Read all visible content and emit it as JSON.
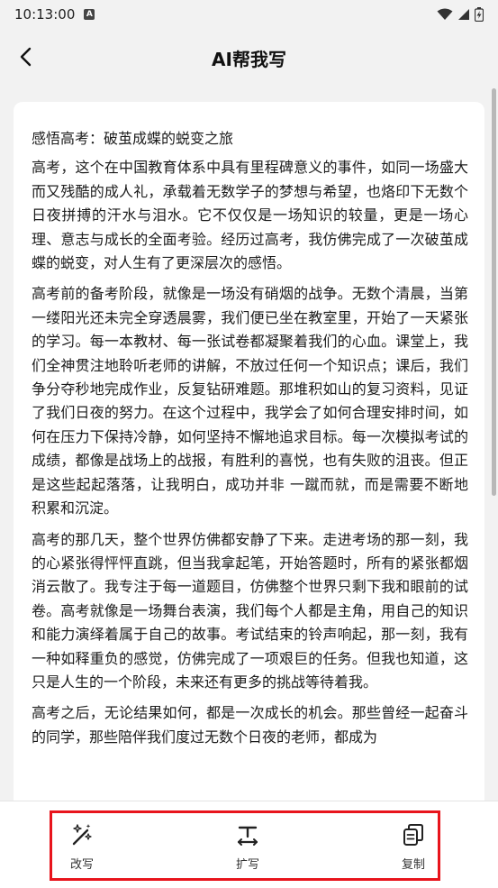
{
  "status": {
    "time": "10:13:00",
    "indicator": "A"
  },
  "header": {
    "title": "AI帮我写"
  },
  "essay": {
    "title": "感悟高考：破茧成蝶的蜕变之旅",
    "paragraphs": [
      "高考，这个在中国教育体系中具有里程碑意义的事件，如同一场盛大而又残酷的成人礼，承载着无数学子的梦想与希望，也烙印下无数个日夜拼搏的汗水与泪水。它不仅仅是一场知识的较量，更是一场心理、意志与成长的全面考验。经历过高考，我仿佛完成了一次破茧成蝶的蜕变，对人生有了更深层次的感悟。",
      "高考前的备考阶段，就像是一场没有硝烟的战争。无数个清晨，当第一缕阳光还未完全穿透晨雾，我们便已坐在教室里，开始了一天紧张的学习。每一本教材、每一张试卷都凝聚着我们的心血。课堂上，我们全神贯注地聆听老师的讲解，不放过任何一个知识点；课后，我们争分夺秒地完成作业，反复钻研难题。那堆积如山的复习资料，见证了我们日夜的努力。在这个过程中，我学会了如何合理安排时间，如何在压力下保持冷静，如何坚持不懈地追求目标。每一次模拟考试的成绩，都像是战场上的战报，有胜利的喜悦，也有失败的沮丧。但正是这些起起落落，让我明白，成功并非 一蹴而就，而是需要不断地积累和沉淀。",
      "高考的那几天，整个世界仿佛都安静了下来。走进考场的那一刻，我的心紧张得怦怦直跳，但当我拿起笔，开始答题时，所有的紧张都烟消云散了。我专注于每一道题目，仿佛整个世界只剩下我和眼前的试卷。高考就像是一场舞台表演，我们每个人都是主角，用自己的知识和能力演绎着属于自己的故事。考试结束的铃声响起，那一刻，我有一种如释重负的感觉，仿佛完成了一项艰巨的任务。但我也知道，这只是人生的一个阶段，未来还有更多的挑战等待着我。",
      "高考之后，无论结果如何，都是一次成长的机会。那些曾经一起奋斗的同学，那些陪伴我们度过无数个日夜的老师，都成为"
    ]
  },
  "actions": {
    "rewrite": {
      "label": "改写",
      "icon": "magic-wand-icon"
    },
    "expand": {
      "label": "扩写",
      "icon": "expand-text-icon"
    },
    "copy": {
      "label": "复制",
      "icon": "copy-icon"
    }
  },
  "colors": {
    "highlight_border": "#e8141c",
    "background": "#f2f2f2"
  }
}
